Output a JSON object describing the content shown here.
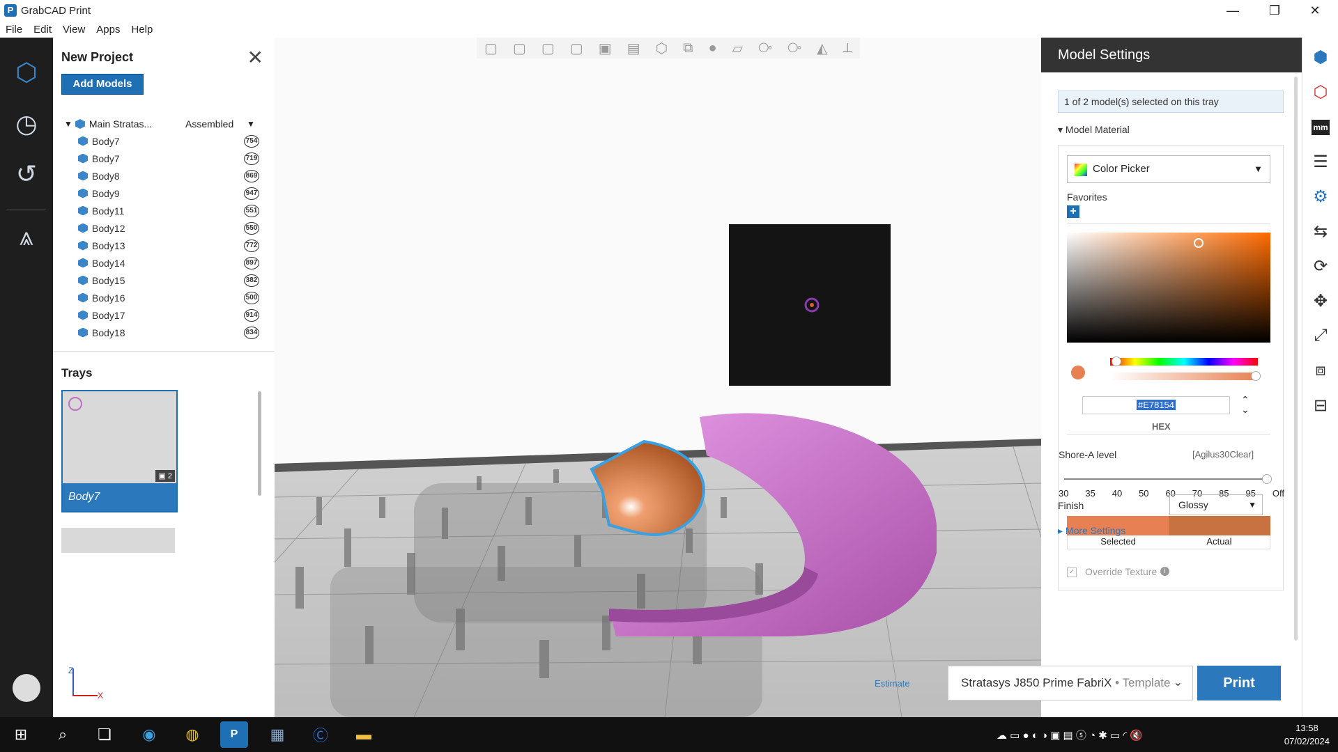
{
  "app": {
    "title": "GrabCAD Print",
    "window_controls": {
      "minimize": "—",
      "restore": "❐",
      "close": "✕"
    }
  },
  "menu": [
    "File",
    "Edit",
    "View",
    "Apps",
    "Help"
  ],
  "project": {
    "title": "New Project",
    "add_models": "Add Models",
    "assembly": {
      "name": "Main Stratas...",
      "state": "Assembled"
    },
    "bodies": [
      {
        "name": "Body7",
        "count": "754"
      },
      {
        "name": "Body7",
        "count": "719"
      },
      {
        "name": "Body8",
        "count": "869"
      },
      {
        "name": "Body9",
        "count": "947"
      },
      {
        "name": "Body11",
        "count": "551"
      },
      {
        "name": "Body12",
        "count": "550"
      },
      {
        "name": "Body13",
        "count": "772"
      },
      {
        "name": "Body14",
        "count": "897"
      },
      {
        "name": "Body15",
        "count": "382"
      },
      {
        "name": "Body16",
        "count": "500"
      },
      {
        "name": "Body17",
        "count": "914"
      },
      {
        "name": "Body18",
        "count": "834"
      }
    ],
    "trays_title": "Trays",
    "tray": {
      "label": "Body7",
      "models": "2"
    }
  },
  "settings": {
    "title": "Model Settings",
    "selection": "1 of 2 model(s) selected on this tray",
    "material_section": "Model Material",
    "picker": "Color Picker",
    "favorites": "Favorites",
    "hex_value": "#E78154",
    "hex_label": "HEX",
    "shore_label": "Shore-A level",
    "shore_material": "[Agilus30Clear]",
    "shore_ticks": [
      "30",
      "35",
      "40",
      "50",
      "60",
      "70",
      "85",
      "95",
      "Off"
    ],
    "selected_label": "Selected",
    "actual_label": "Actual",
    "selected_color": "#e78154",
    "actual_color": "#c97241",
    "override_texture": "Override Texture",
    "finish_label": "Finish",
    "finish_value": "Glossy",
    "more_settings": "More Settings"
  },
  "axes": {
    "z": "Z",
    "x": "X"
  },
  "printer": {
    "name": "Stratasys J850 Prime FabriX",
    "mode": "Template",
    "print": "Print",
    "estimate": "Estimate"
  },
  "taskbar": {
    "time": "13:58",
    "date": "07/02/2024"
  },
  "colors": {
    "accent": "#2c78bd",
    "rail": "#1e1e1e",
    "ring": "#c070c0"
  }
}
